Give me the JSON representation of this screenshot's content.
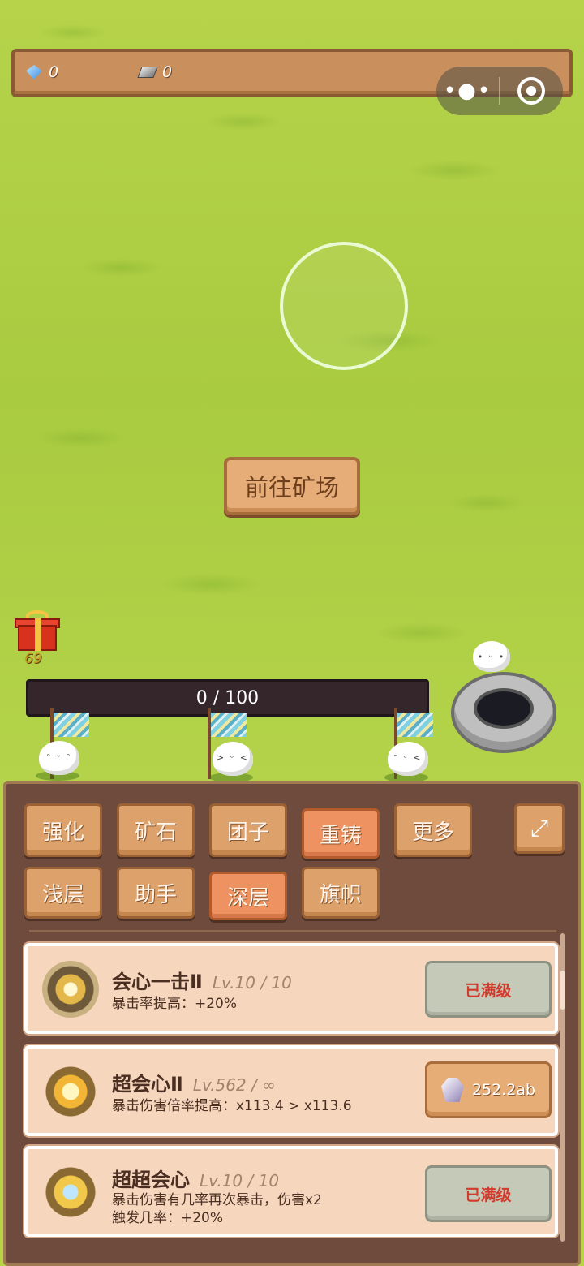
{
  "resources": {
    "gems": "0",
    "ingots": "0"
  },
  "capsule": {
    "more_icon": "more-dots-icon",
    "close_icon": "target-icon"
  },
  "goto_mine_label": "前往矿场",
  "gift": {
    "count": "69"
  },
  "progress": {
    "text": "0 / 100",
    "current": 0,
    "max": 100
  },
  "tabs_row1": [
    {
      "label": "强化",
      "active": false
    },
    {
      "label": "矿石",
      "active": false
    },
    {
      "label": "团子",
      "active": false
    },
    {
      "label": "重铸",
      "active": true
    },
    {
      "label": "更多",
      "active": false
    }
  ],
  "tabs_row2": [
    {
      "label": "浅层",
      "active": false
    },
    {
      "label": "助手",
      "active": false
    },
    {
      "label": "深层",
      "active": true
    },
    {
      "label": "旗帜",
      "active": false
    }
  ],
  "skills": [
    {
      "title": "会心一击Ⅱ",
      "level": "Lv.10 / 10",
      "desc": "暴击率提高：+20%",
      "button": "已满级"
    },
    {
      "title": "超会心Ⅱ",
      "level": "Lv.562 / ∞",
      "desc": "暴击伤害倍率提高：x113.4 > x113.6",
      "button": "252.2ab"
    },
    {
      "title": "超超会心",
      "level": "Lv.10 / 10",
      "desc1": "暴击伤害有几率再次暴击，伤害x2",
      "desc2": "触发几率：+20%",
      "button": "已满级"
    }
  ],
  "colors": {
    "grass": "#b6d34a",
    "panel": "#6e4b3c",
    "tab": "#dda26b",
    "tab_active": "#ef9261",
    "card": "#f6d7bd",
    "maxed_text": "#d23a2c"
  }
}
